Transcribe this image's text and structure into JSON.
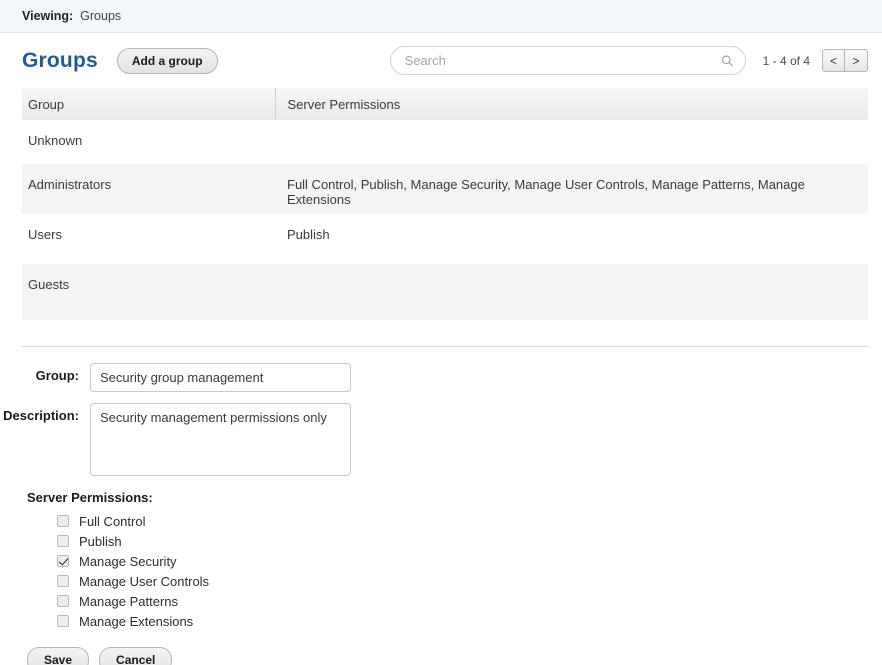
{
  "viewing": {
    "label": "Viewing:",
    "value": "Groups"
  },
  "header": {
    "title": "Groups",
    "add_button": "Add a group",
    "search_placeholder": "Search",
    "search_value": "",
    "search_icon": "search-icon",
    "pager_count": "1 - 4 of 4",
    "prev_label": "<",
    "next_label": ">"
  },
  "table": {
    "columns": [
      "Group",
      "Server Permissions"
    ],
    "rows": [
      {
        "group": "Unknown",
        "permissions": ""
      },
      {
        "group": "Administrators",
        "permissions": "Full Control, Publish, Manage Security, Manage User Controls, Manage Patterns, Manage Extensions"
      },
      {
        "group": "Users",
        "permissions": "Publish"
      },
      {
        "group": "Guests",
        "permissions": ""
      }
    ]
  },
  "form": {
    "group_label": "Group:",
    "group_value": "Security group management",
    "group_placeholder": "",
    "description_label": "Description:",
    "description_value": "Security management permissions only",
    "description_placeholder": "",
    "permissions_title": "Server Permissions:",
    "permissions": [
      {
        "label": "Full Control",
        "checked": false
      },
      {
        "label": "Publish",
        "checked": false
      },
      {
        "label": "Manage Security",
        "checked": true
      },
      {
        "label": "Manage User Controls",
        "checked": false
      },
      {
        "label": "Manage Patterns",
        "checked": false
      },
      {
        "label": "Manage Extensions",
        "checked": false
      }
    ],
    "save_label": "Save",
    "cancel_label": "Cancel"
  },
  "colors": {
    "title_blue": "#1f5c99",
    "viewing_bar": "#f2f7fb",
    "row_alt": "#f4f4f4",
    "header_grad_top": "#f7f7f7",
    "header_grad_bottom": "#e9e9e9"
  }
}
